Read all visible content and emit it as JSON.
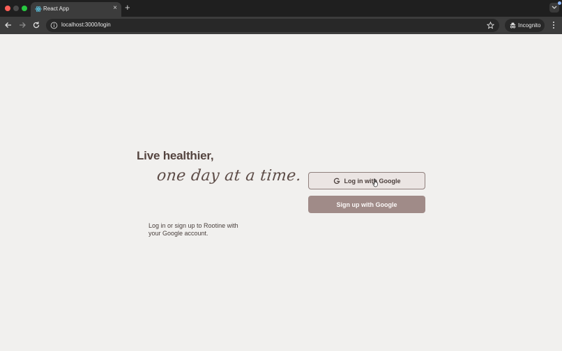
{
  "browser": {
    "tab": {
      "title": "React App",
      "favicon": "react-icon",
      "close_glyph": "×"
    },
    "new_tab_glyph": "+",
    "url": "localhost:3000/login",
    "incognito_label": "Incognito"
  },
  "login": {
    "headline": "Live healthier,",
    "tagline": "one day at a time.",
    "description": "Log in or sign up to Rootine with your Google account.",
    "login_button": "Log in with Google",
    "signup_button": "Sign up with Google"
  },
  "colors": {
    "page_background": "#f1f0ee",
    "text_brown": "#54443f",
    "login_button_border": "#8f7f7c",
    "signup_button_bg": "#a08b88"
  }
}
